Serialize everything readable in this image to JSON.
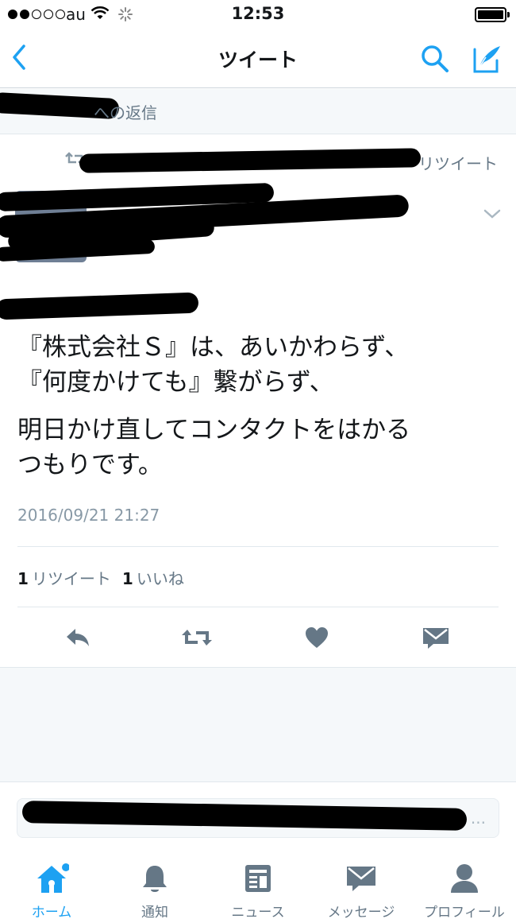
{
  "status_bar": {
    "carrier": "au",
    "time": "12:53",
    "signal_bars_filled": 2,
    "signal_bars_total": 5
  },
  "nav": {
    "title": "ツイート",
    "back_icon": "chevron-left-icon",
    "search_icon": "search-icon",
    "compose_icon": "compose-icon"
  },
  "reply_context": {
    "text": "への返信"
  },
  "tweet": {
    "retweeted_by_suffix": "リツイート",
    "body_paragraphs": [
      "『株式会社Ｓ』は、あいかわらず、\n『何度かけても』繋がらず、",
      "明日かけ直してコンタクトをはかる\nつもりです。"
    ],
    "timestamp": "2016/09/21 21:27",
    "retweet_count": "1",
    "retweet_label": "リツイート",
    "like_count": "1",
    "like_label": "いいね"
  },
  "reply_input": {
    "placeholder": "..."
  },
  "tabs": [
    {
      "label": "ホーム",
      "icon": "home-icon",
      "active": true
    },
    {
      "label": "通知",
      "icon": "bell-icon",
      "active": false
    },
    {
      "label": "ニュース",
      "icon": "news-icon",
      "active": false
    },
    {
      "label": "メッセージ",
      "icon": "message-icon",
      "active": false
    },
    {
      "label": "プロフィール",
      "icon": "profile-icon",
      "active": false
    }
  ],
  "colors": {
    "accent": "#1da1f2",
    "icon_gray": "#657786",
    "text_primary": "#14171a",
    "text_secondary": "#657786",
    "background_gray": "#f5f8fa"
  }
}
